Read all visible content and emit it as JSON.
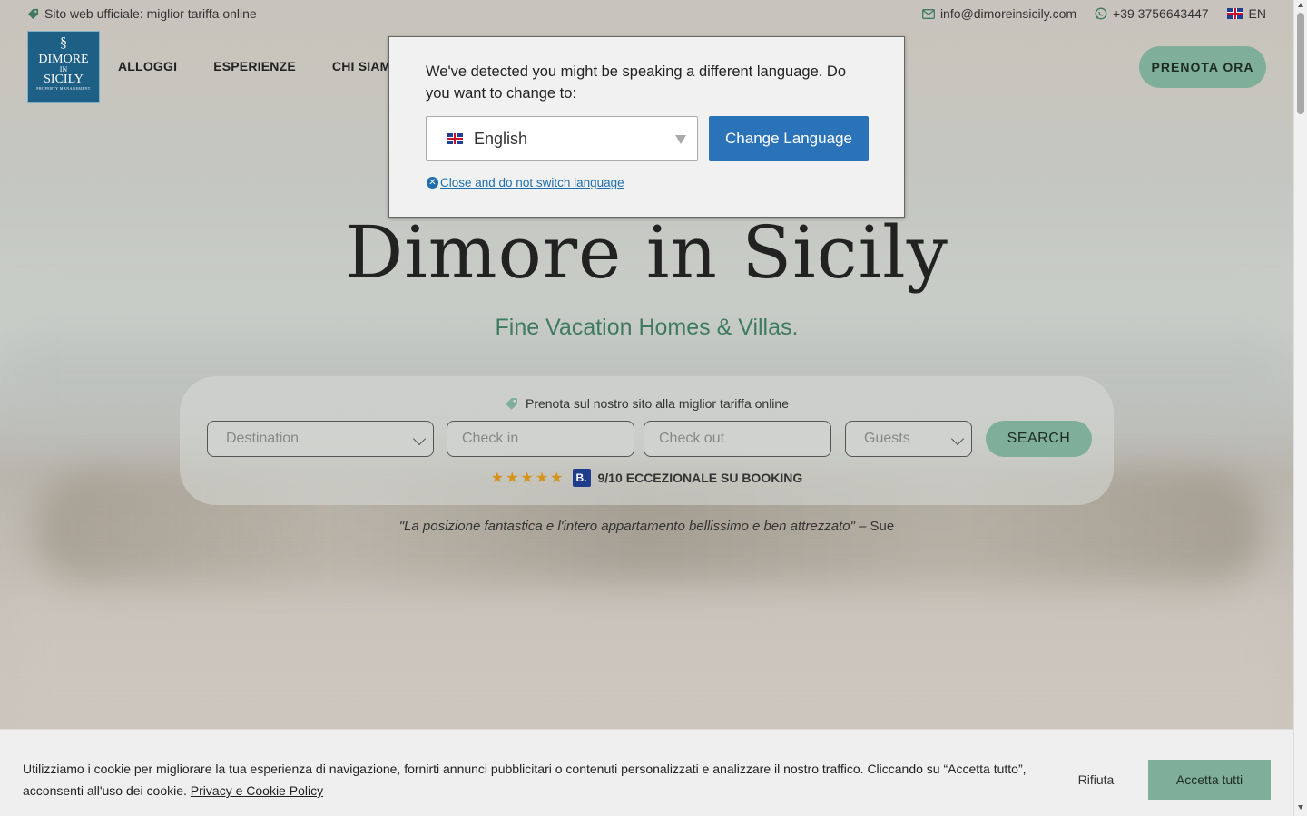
{
  "topbar": {
    "official_site": "Sito web ufficiale: miglior tariffa online",
    "email": "info@dimoreinsicily.com",
    "phone": "+39 3756643447",
    "lang": "EN"
  },
  "logo": {
    "line1": "DIMORE",
    "line2": "IN",
    "line3": "SICILY",
    "line4": "PROPERTY MANAGEMENT"
  },
  "nav": {
    "items": [
      "ALLOGGI",
      "ESPERIENZE",
      "CHI SIAMO"
    ],
    "book_label": "PRENOTA ORA"
  },
  "hero": {
    "title": "Dimore in Sicily",
    "subtitle": "Fine Vacation Homes & Villas."
  },
  "search": {
    "tagline": "Prenota sul nostro sito alla miglior tariffa online",
    "destination_placeholder": "Destination",
    "checkin_placeholder": "Check in",
    "checkout_placeholder": "Check out",
    "guests_placeholder": "Guests",
    "search_label": "SEARCH"
  },
  "rating": {
    "stars": "★★★★★",
    "badge": "B.",
    "score": "9/10",
    "text": "ECCEZIONALE SU BOOKING"
  },
  "quote": {
    "text": "\"La posizione fantastica e l'intero appartamento bellissimo e ben attrezzato\"",
    "author": " – Sue"
  },
  "language_popup": {
    "message": "We've detected you might be speaking a different language. Do you want to change to:",
    "selected_language": "English",
    "change_label": "Change Language",
    "close_label": "Close and do not switch language"
  },
  "cookie": {
    "text": "Utilizziamo i cookie per migliorare la tua esperienza di navigazione, fornirti annunci pubblicitari o contenuti personalizzati e analizzare il nostro traffico. Cliccando su “Accetta tutto”, acconsenti all'uso dei cookie.",
    "policy_link": "Privacy e Cookie Policy",
    "reject_label": "Rifiuta",
    "accept_label": "Accetta tutti"
  },
  "colors": {
    "accent": "#7fae9a",
    "brand": "#1d5f85",
    "subtitle": "#3f7a62",
    "popup_button": "#2b73b8"
  },
  "icons": [
    "tag-icon",
    "mail-icon",
    "whatsapp-icon",
    "uk-flag-icon",
    "chevron-down-icon",
    "close-circle-icon",
    "star-icon",
    "booking-icon"
  ]
}
